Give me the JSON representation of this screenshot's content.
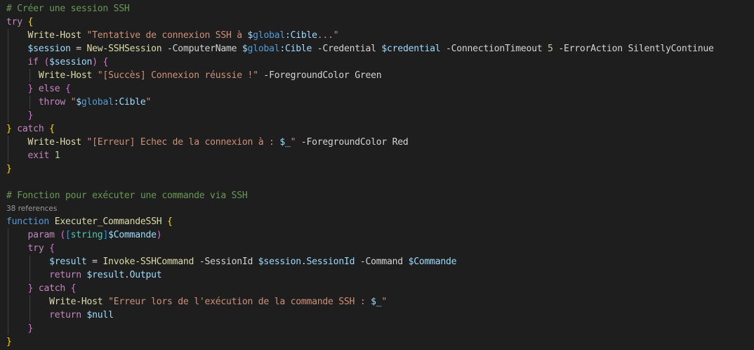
{
  "editor": {
    "codelens": {
      "references": "38 references"
    },
    "lines": [
      {
        "tokens": [
          {
            "t": "# Créer une session SSH",
            "c": "cmt"
          }
        ]
      },
      {
        "tokens": [
          {
            "t": "try",
            "c": "kw"
          },
          {
            "t": " "
          },
          {
            "t": "{",
            "c": "br1"
          }
        ]
      },
      {
        "tokens": [
          {
            "t": "    "
          },
          {
            "t": "Write-Host",
            "c": "cmd"
          },
          {
            "t": " "
          },
          {
            "t": "\"Tentative de connexion SSH à ",
            "c": "str"
          },
          {
            "t": "$",
            "c": "var"
          },
          {
            "t": "global",
            "c": "pvar"
          },
          {
            "t": ":Cible",
            "c": "var"
          },
          {
            "t": "...\"",
            "c": "str"
          }
        ]
      },
      {
        "tokens": [
          {
            "t": "    "
          },
          {
            "t": "$session",
            "c": "var"
          },
          {
            "t": " = "
          },
          {
            "t": "New-SSHSession",
            "c": "cmd"
          },
          {
            "t": " -ComputerName "
          },
          {
            "t": "$",
            "c": "var"
          },
          {
            "t": "global",
            "c": "pvar"
          },
          {
            "t": ":Cible",
            "c": "var"
          },
          {
            "t": " -Credential "
          },
          {
            "t": "$credential",
            "c": "var"
          },
          {
            "t": " -ConnectionTimeout "
          },
          {
            "t": "5",
            "c": "num"
          },
          {
            "t": " -ErrorAction SilentlyContinue"
          }
        ]
      },
      {
        "tokens": [
          {
            "t": "    "
          },
          {
            "t": "if",
            "c": "kw"
          },
          {
            "t": " "
          },
          {
            "t": "(",
            "c": "br2"
          },
          {
            "t": "$session",
            "c": "var"
          },
          {
            "t": ")",
            "c": "br2"
          },
          {
            "t": " "
          },
          {
            "t": "{",
            "c": "br2"
          }
        ]
      },
      {
        "tokens": [
          {
            "t": "      "
          },
          {
            "t": "Write-Host",
            "c": "cmd"
          },
          {
            "t": " "
          },
          {
            "t": "\"[Succès] Connexion réussie !\"",
            "c": "str"
          },
          {
            "t": " -ForegroundColor Green"
          }
        ]
      },
      {
        "tokens": [
          {
            "t": "    "
          },
          {
            "t": "}",
            "c": "br2"
          },
          {
            "t": " "
          },
          {
            "t": "else",
            "c": "kw"
          },
          {
            "t": " "
          },
          {
            "t": "{",
            "c": "br2"
          }
        ]
      },
      {
        "tokens": [
          {
            "t": "      "
          },
          {
            "t": "throw",
            "c": "kw"
          },
          {
            "t": " "
          },
          {
            "t": "\"",
            "c": "str"
          },
          {
            "t": "$",
            "c": "var"
          },
          {
            "t": "global",
            "c": "pvar"
          },
          {
            "t": ":Cible",
            "c": "var"
          },
          {
            "t": "\"",
            "c": "str"
          }
        ]
      },
      {
        "tokens": [
          {
            "t": "    "
          },
          {
            "t": "}",
            "c": "br2"
          }
        ]
      },
      {
        "tokens": [
          {
            "t": "}",
            "c": "br1"
          },
          {
            "t": " "
          },
          {
            "t": "catch",
            "c": "kw"
          },
          {
            "t": " "
          },
          {
            "t": "{",
            "c": "br1"
          }
        ]
      },
      {
        "tokens": [
          {
            "t": "    "
          },
          {
            "t": "Write-Host",
            "c": "cmd"
          },
          {
            "t": " "
          },
          {
            "t": "\"[Erreur] Echec de la connexion à : ",
            "c": "str"
          },
          {
            "t": "$_",
            "c": "var"
          },
          {
            "t": "\"",
            "c": "str"
          },
          {
            "t": " -ForegroundColor Red"
          }
        ]
      },
      {
        "tokens": [
          {
            "t": "    "
          },
          {
            "t": "exit",
            "c": "kw"
          },
          {
            "t": " "
          },
          {
            "t": "1",
            "c": "num"
          }
        ]
      },
      {
        "tokens": [
          {
            "t": "}",
            "c": "br1"
          }
        ]
      },
      {
        "tokens": []
      },
      {
        "tokens": [
          {
            "t": "# Fonction pour exécuter une commande via SSH",
            "c": "cmt"
          }
        ]
      },
      {
        "tokens": [
          {
            "t": "function",
            "c": "kwb"
          },
          {
            "t": " "
          },
          {
            "t": "Executer_CommandeSSH",
            "c": "cmd"
          },
          {
            "t": " "
          },
          {
            "t": "{",
            "c": "br1"
          }
        ]
      },
      {
        "tokens": [
          {
            "t": "    "
          },
          {
            "t": "param",
            "c": "kw"
          },
          {
            "t": " "
          },
          {
            "t": "(",
            "c": "br2"
          },
          {
            "t": "[",
            "c": "br3"
          },
          {
            "t": "string",
            "c": "type"
          },
          {
            "t": "]",
            "c": "br3"
          },
          {
            "t": "$Commande",
            "c": "var"
          },
          {
            "t": ")",
            "c": "br2"
          }
        ]
      },
      {
        "tokens": [
          {
            "t": "    "
          },
          {
            "t": "try",
            "c": "kw"
          },
          {
            "t": " "
          },
          {
            "t": "{",
            "c": "br2"
          }
        ]
      },
      {
        "tokens": [
          {
            "t": "        "
          },
          {
            "t": "$result",
            "c": "var"
          },
          {
            "t": " = "
          },
          {
            "t": "Invoke-SSHCommand",
            "c": "cmd"
          },
          {
            "t": " -SessionId "
          },
          {
            "t": "$session",
            "c": "var"
          },
          {
            "t": "."
          },
          {
            "t": "SessionId",
            "c": "var"
          },
          {
            "t": " -Command "
          },
          {
            "t": "$Commande",
            "c": "var"
          }
        ]
      },
      {
        "tokens": [
          {
            "t": "        "
          },
          {
            "t": "return",
            "c": "kw"
          },
          {
            "t": " "
          },
          {
            "t": "$result",
            "c": "var"
          },
          {
            "t": "."
          },
          {
            "t": "Output",
            "c": "var"
          }
        ]
      },
      {
        "tokens": [
          {
            "t": "    "
          },
          {
            "t": "}",
            "c": "br2"
          },
          {
            "t": " "
          },
          {
            "t": "catch",
            "c": "kw"
          },
          {
            "t": " "
          },
          {
            "t": "{",
            "c": "br2"
          }
        ]
      },
      {
        "tokens": [
          {
            "t": "        "
          },
          {
            "t": "Write-Host",
            "c": "cmd"
          },
          {
            "t": " "
          },
          {
            "t": "\"Erreur lors de l'exécution de la commande SSH : ",
            "c": "str"
          },
          {
            "t": "$_",
            "c": "var"
          },
          {
            "t": "\"",
            "c": "str"
          }
        ]
      },
      {
        "tokens": [
          {
            "t": "        "
          },
          {
            "t": "return",
            "c": "kw"
          },
          {
            "t": " "
          },
          {
            "t": "$null",
            "c": "var"
          }
        ]
      },
      {
        "tokens": [
          {
            "t": "    "
          },
          {
            "t": "}",
            "c": "br2"
          }
        ]
      },
      {
        "tokens": [
          {
            "t": "}",
            "c": "br1"
          }
        ]
      }
    ]
  }
}
